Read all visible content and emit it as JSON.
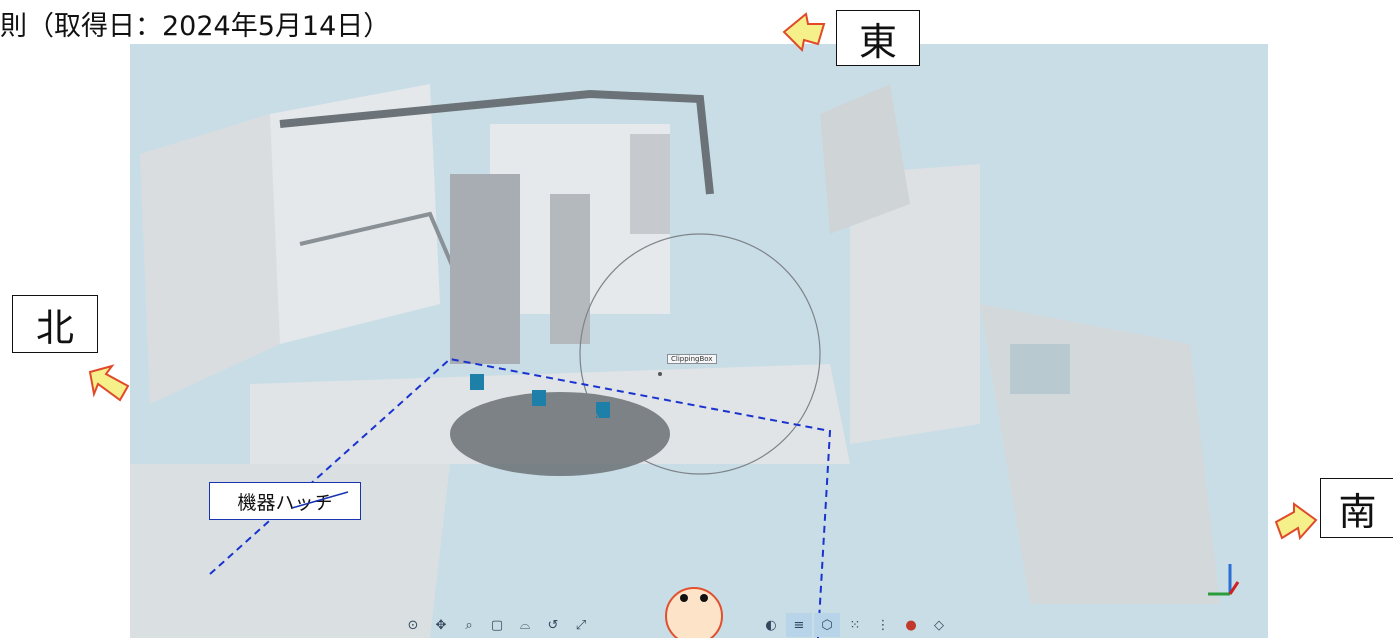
{
  "header": {
    "title": "則（取得日：2024年5月14日）"
  },
  "directions": {
    "east": "東",
    "north": "北",
    "south": "南"
  },
  "annotation": {
    "hatch_label": "機器ハッチ"
  },
  "viewport": {
    "clipping_box_label": "ClippingBox"
  },
  "toolbar": {
    "tools": [
      {
        "name": "orbit-tool",
        "icon": "orbit-icon"
      },
      {
        "name": "pan-tool",
        "icon": "pan-icon"
      },
      {
        "name": "zoom-tool",
        "icon": "zoom-icon"
      },
      {
        "name": "fit-view-tool",
        "icon": "cube-icon"
      },
      {
        "name": "walk-tool",
        "icon": "walk-icon"
      },
      {
        "name": "measure-tool",
        "icon": "measure-icon"
      },
      {
        "name": "section-tool",
        "icon": "section-icon"
      },
      {
        "name": "clip-tool",
        "icon": "clip-icon"
      },
      {
        "name": "layers-tool",
        "icon": "layers-icon"
      },
      {
        "name": "box-tool",
        "icon": "box-icon"
      },
      {
        "name": "points-tool",
        "icon": "points-icon"
      },
      {
        "name": "density-tool",
        "icon": "density-icon"
      },
      {
        "name": "color-tool",
        "icon": "color-icon"
      },
      {
        "name": "render-tool",
        "icon": "render-icon"
      }
    ]
  },
  "colors": {
    "arrow_fill": "#f6f08a",
    "arrow_stroke": "#e04a2a",
    "dash": "#1a33d0",
    "sky": "#c9dde6"
  }
}
